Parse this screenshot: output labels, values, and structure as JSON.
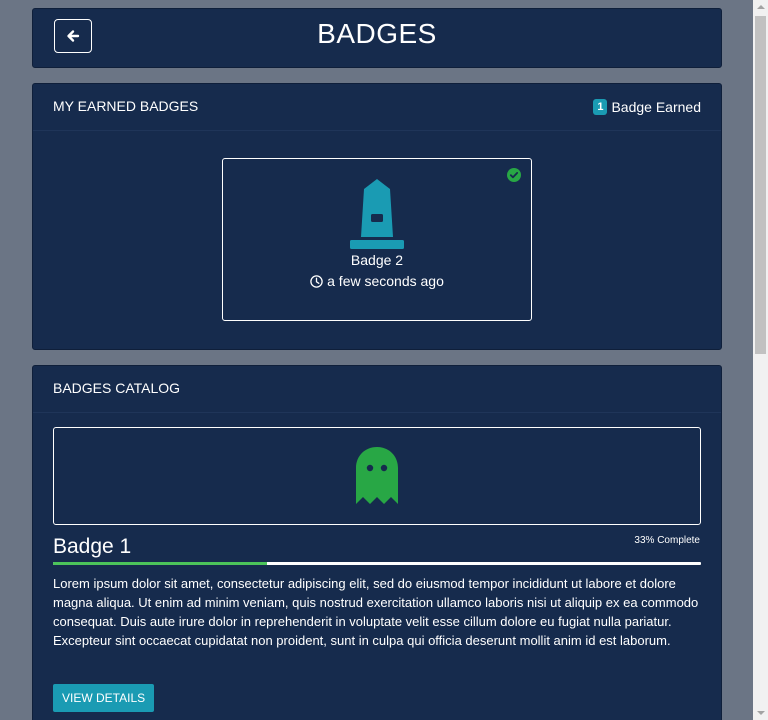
{
  "page": {
    "title": "BADGES"
  },
  "header": {
    "back_icon": "arrow-left-icon"
  },
  "earned": {
    "title": "MY EARNED BADGES",
    "count": "1",
    "count_label": "Badge Earned",
    "badge": {
      "name": "Badge 2",
      "time": "a few seconds ago",
      "icon": "monument-icon",
      "status_icon": "check-circle-icon"
    }
  },
  "catalog": {
    "title": "BADGES CATALOG",
    "items": [
      {
        "name": "Badge 1",
        "icon": "ghost-icon",
        "progress_text": "33% Complete",
        "progress": 0.33,
        "description": "Lorem ipsum dolor sit amet, consectetur adipiscing elit, sed do eiusmod tempor incididunt ut labore et dolore magna aliqua. Ut enim ad minim veniam, quis nostrud exercitation ullamco laboris nisi ut aliquip ex ea commodo consequat. Duis aute irure dolor in reprehenderit in voluptate velit esse cillum dolore eu fugiat nulla pariatur. Excepteur sint occaecat cupidatat non proident, sunt in culpa qui officia deserunt mollit anim id est laborum.",
        "button_label": "VIEW DETAILS"
      }
    ]
  },
  "colors": {
    "card_bg": "#162b4d",
    "page_bg": "#6b7585",
    "accent": "#1a9bb3",
    "success": "#28a745",
    "progress": "#4cc45a"
  }
}
